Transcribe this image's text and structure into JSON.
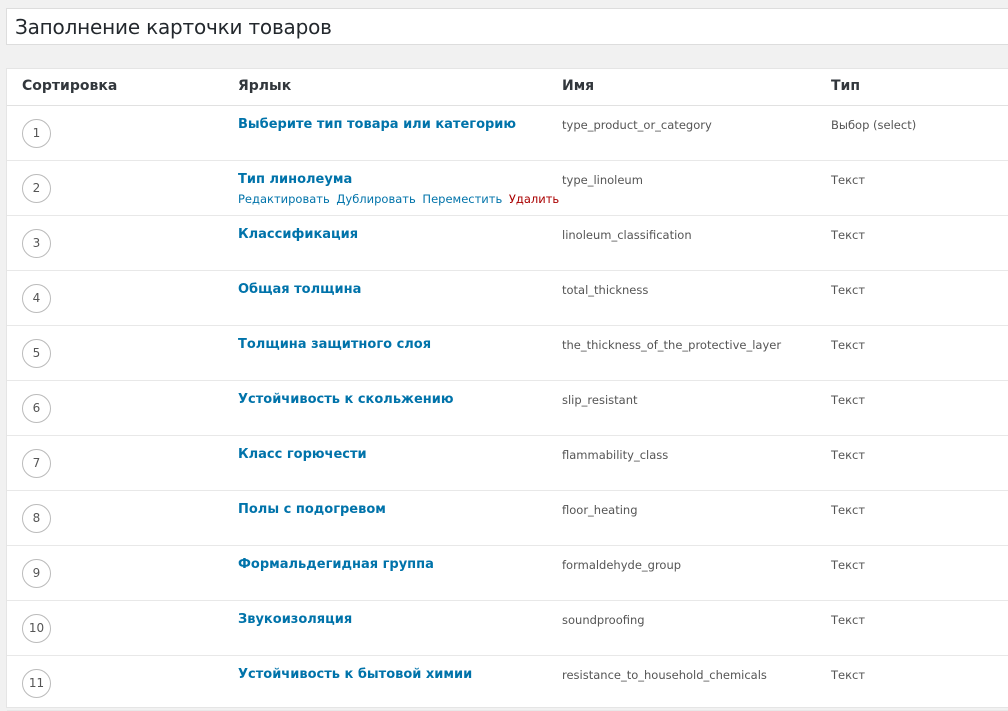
{
  "page": {
    "title": "Заполнение карточки товаров"
  },
  "table": {
    "columns": {
      "order": "Сортировка",
      "label": "Ярлык",
      "name": "Имя",
      "type": "Тип"
    },
    "row_actions": {
      "edit": "Редактировать",
      "duplicate": "Дублировать",
      "move": "Переместить",
      "delete": "Удалить"
    },
    "rows": [
      {
        "order": "1",
        "label": "Выберите тип товара или категорию",
        "name": "type_product_or_category",
        "type": "Выбор (select)"
      },
      {
        "order": "2",
        "label": "Тип линолеума",
        "name": "type_linoleum",
        "type": "Текст"
      },
      {
        "order": "3",
        "label": "Классификация",
        "name": "linoleum_classification",
        "type": "Текст"
      },
      {
        "order": "4",
        "label": "Общая толщина",
        "name": "total_thickness",
        "type": "Текст"
      },
      {
        "order": "5",
        "label": "Толщина защитного слоя",
        "name": "the_thickness_of_the_protective_layer",
        "type": "Текст"
      },
      {
        "order": "6",
        "label": "Устойчивость к скольжению",
        "name": "slip_resistant",
        "type": "Текст"
      },
      {
        "order": "7",
        "label": "Класс горючести",
        "name": "flammability_class",
        "type": "Текст"
      },
      {
        "order": "8",
        "label": "Полы с подогревом",
        "name": "floor_heating",
        "type": "Текст"
      },
      {
        "order": "9",
        "label": "Формальдегидная группа",
        "name": "formaldehyde_group",
        "type": "Текст"
      },
      {
        "order": "10",
        "label": "Звукоизоляция",
        "name": "soundproofing",
        "type": "Текст"
      },
      {
        "order": "11",
        "label": "Устойчивость к бытовой химии",
        "name": "resistance_to_household_chemicals",
        "type": "Текст"
      }
    ]
  }
}
